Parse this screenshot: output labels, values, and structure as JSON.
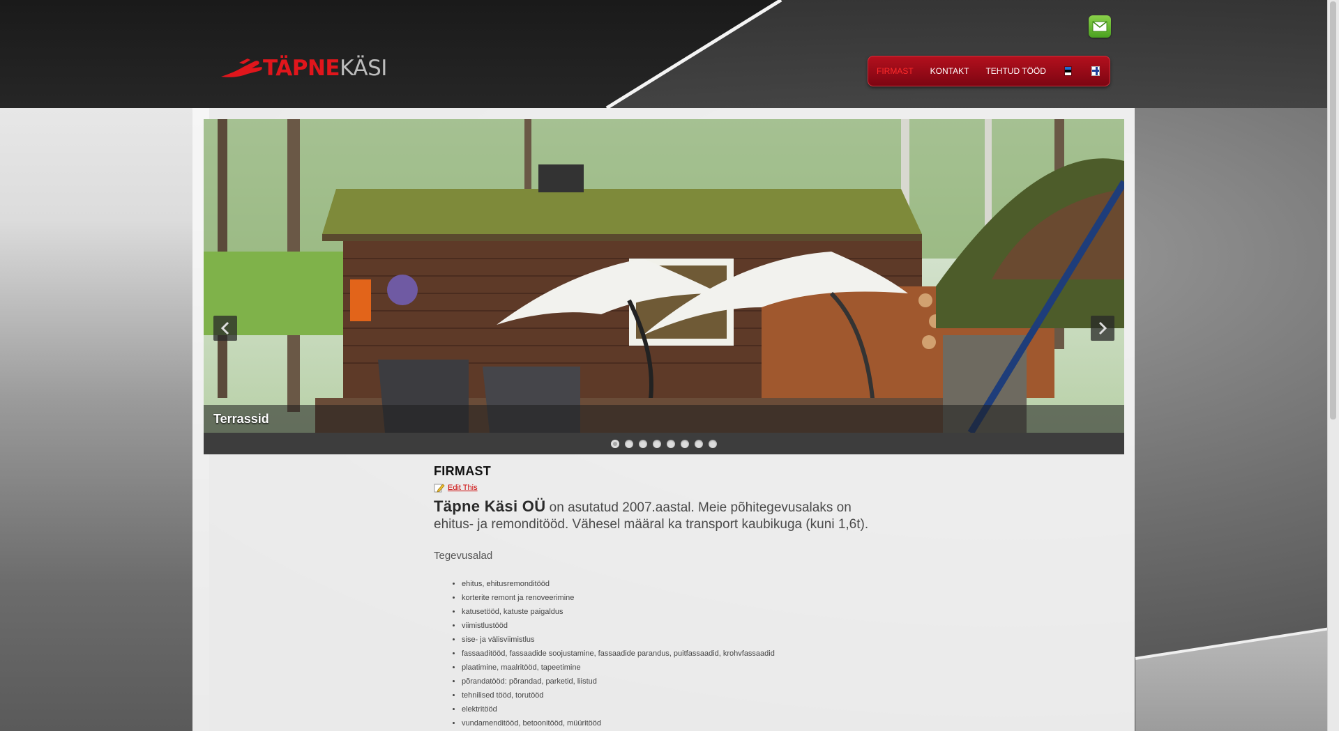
{
  "header": {
    "logo_part1": "TÄPNE",
    "logo_part2": "KÄSI",
    "nav": [
      {
        "label": "FIRMAST",
        "active": true
      },
      {
        "label": "KONTAKT",
        "active": false
      },
      {
        "label": "TEHTUD TÖÖD",
        "active": false
      }
    ],
    "languages": [
      "Estonian flag",
      "Finnish flag"
    ],
    "accent_color": "#b3101d"
  },
  "slider": {
    "caption": "Terrassid",
    "slide_count": 8,
    "active_index": 0
  },
  "content": {
    "title": "FIRMAST",
    "edit_link": "Edit This",
    "company_name": "Täpne Käsi OÜ",
    "intro_text": " on asutatud 2007.aastal. Meie põhitegevusalaks on ehitus- ja remonditööd. Vähesel määral ka transport kaubikuga (kuni 1,6t).",
    "section_label": "Tegevusalad",
    "services": [
      "ehitus, ehitusremonditööd",
      "korterite remont ja renoveerimine",
      "katusetööd, katuste paigaldus",
      "viimistlustööd",
      "sise- ja välisviimistlus",
      "fassaaditööd, fassaadide soojustamine, fassaadide parandus, puitfassaadid, krohvfassaadid",
      "plaatimine, maalritööd, tapeetimine",
      "põrandatööd: põrandad, parketid, liistud",
      "tehnilised tööd, torutööd",
      "elektritööd",
      "vundamenditööd, betoonitööd, müüritööd"
    ]
  }
}
